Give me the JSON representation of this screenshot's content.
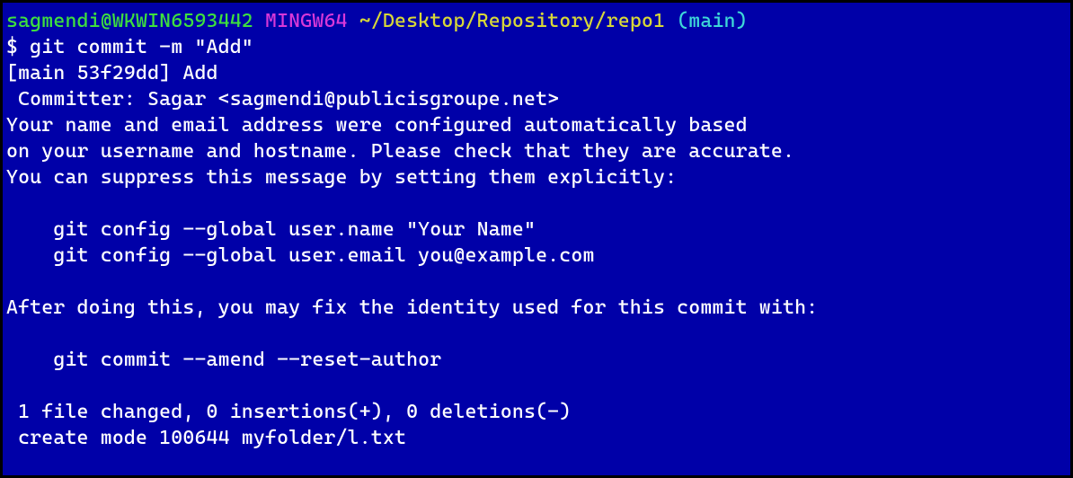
{
  "prompt": {
    "user_host": "sagmendi@WKWIN6593442",
    "mingw": "MINGW64",
    "path": "~/Desktop/Repository/repo1",
    "branch": "(main)"
  },
  "command": "$ git commit -m \"Add\"",
  "output": {
    "line1": "[main 53f29dd] Add",
    "line2": " Committer: Sagar <sagmendi@publicisgroupe.net>",
    "line3": "Your name and email address were configured automatically based",
    "line4": "on your username and hostname. Please check that they are accurate.",
    "line5": "You can suppress this message by setting them explicitly:",
    "line6": "",
    "line7": "    git config --global user.name \"Your Name\"",
    "line8": "    git config --global user.email you@example.com",
    "line9": "",
    "line10": "After doing this, you may fix the identity used for this commit with:",
    "line11": "",
    "line12": "    git commit --amend --reset-author",
    "line13": "",
    "line14": " 1 file changed, 0 insertions(+), 0 deletions(-)",
    "line15": " create mode 100644 myfolder/l.txt"
  }
}
